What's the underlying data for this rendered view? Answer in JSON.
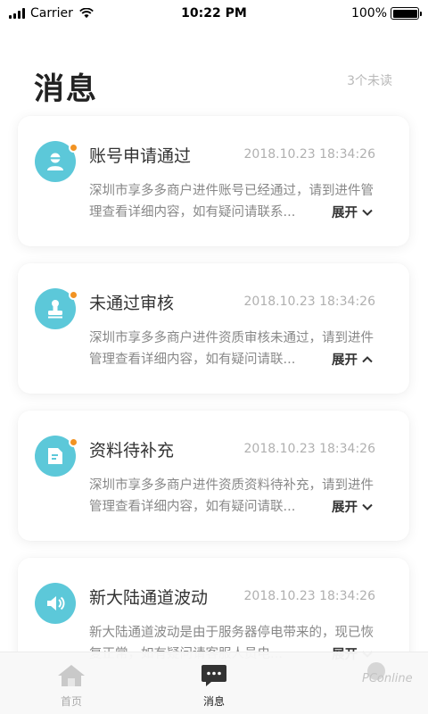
{
  "status_bar": {
    "carrier": "Carrier",
    "time": "10:22 PM",
    "battery": "100%"
  },
  "header": {
    "title": "消息",
    "unread": "3个未读"
  },
  "messages": [
    {
      "icon": "user-icon",
      "title": "账号申请通过",
      "time": "2018.10.23 18:34:26",
      "body": "深圳市享多多商户进件账号已经通过，请到进件管理查看详细内容，如有疑问请联系...",
      "expand": "展开",
      "expand_icon": "chevron-down-icon",
      "unread": true
    },
    {
      "icon": "stamp-icon",
      "title": "未通过审核",
      "time": "2018.10.23 18:34:26",
      "body": "深圳市享多多商户进件资质审核未通过，请到进件管理查看详细内容，如有疑问请联...",
      "expand": "展开",
      "expand_icon": "chevron-up-icon",
      "unread": true
    },
    {
      "icon": "document-icon",
      "title": "资料待补充",
      "time": "2018.10.23 18:34:26",
      "body": "深圳市享多多商户进件资质资料待补充，请到进件管理查看详细内容，如有疑问请联...",
      "expand": "展开",
      "expand_icon": "chevron-down-icon",
      "unread": true
    },
    {
      "icon": "speaker-icon",
      "title": "新大陆通道波动",
      "time": "2018.10.23 18:34:26",
      "body": "新大陆通道波动是由于服务器停电带来的，现已恢复正常，如有疑问请客服人员电...",
      "expand": "展开",
      "expand_icon": "chevron-down-icon",
      "unread": false
    }
  ],
  "tab_bar": {
    "home": "首页",
    "messages": "消息"
  },
  "watermark": "PConline",
  "colors": {
    "accent": "#5cc8d9",
    "unread_dot": "#f29322",
    "title": "#222222",
    "muted": "#b0b0b0"
  }
}
